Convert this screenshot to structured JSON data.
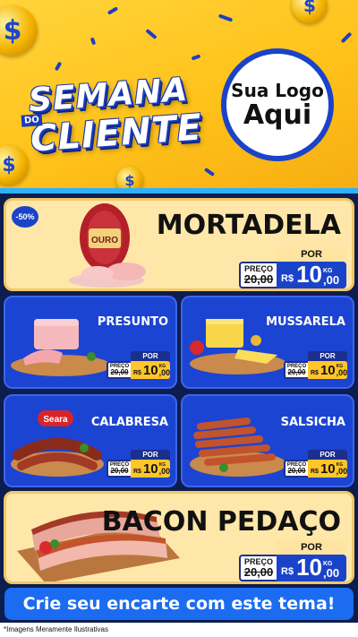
{
  "header": {
    "title_line1": "SEMANA",
    "title_small": "DO",
    "title_line2": "CLIENTE",
    "logo_line1": "Sua Logo",
    "logo_line2": "Aqui",
    "coin_symbol": "$"
  },
  "colors": {
    "brand_blue": "#1b43c9",
    "yellow": "#ffc21a",
    "card_cream": "#ffe7a9",
    "cta_blue": "#1b6cf0"
  },
  "products": [
    {
      "name": "MORTADELA",
      "badge": "-50%",
      "brand": "OURO",
      "por": "POR",
      "price_label": "PREÇO",
      "old_price": "20,00",
      "currency": "R$",
      "int": "10",
      "dec": ",00",
      "unit": "KG"
    },
    {
      "name": "PRESUNTO",
      "por": "POR",
      "price_label": "PREÇO",
      "old_price": "20,00",
      "currency": "R$",
      "int": "10",
      "dec": ",00",
      "unit": "KG"
    },
    {
      "name": "MUSSARELA",
      "por": "POR",
      "price_label": "PREÇO",
      "old_price": "20,00",
      "currency": "R$",
      "int": "10",
      "dec": ",00",
      "unit": "KG"
    },
    {
      "name": "CALABRESA",
      "brand": "Seara",
      "por": "POR",
      "price_label": "PREÇO",
      "old_price": "20,00",
      "currency": "R$",
      "int": "10",
      "dec": ",00",
      "unit": "KG"
    },
    {
      "name": "SALSICHA",
      "por": "POR",
      "price_label": "PREÇO",
      "old_price": "20,00",
      "currency": "R$",
      "int": "10",
      "dec": ",00",
      "unit": "KG"
    },
    {
      "name": "BACON PEDAÇO",
      "por": "POR",
      "price_label": "PREÇO",
      "old_price": "20,00",
      "currency": "R$",
      "int": "10",
      "dec": ",00",
      "unit": "KG"
    }
  ],
  "cta": "Crie seu encarte com este tema!",
  "footer_note": "*Imagens Meramente Ilustrativas"
}
